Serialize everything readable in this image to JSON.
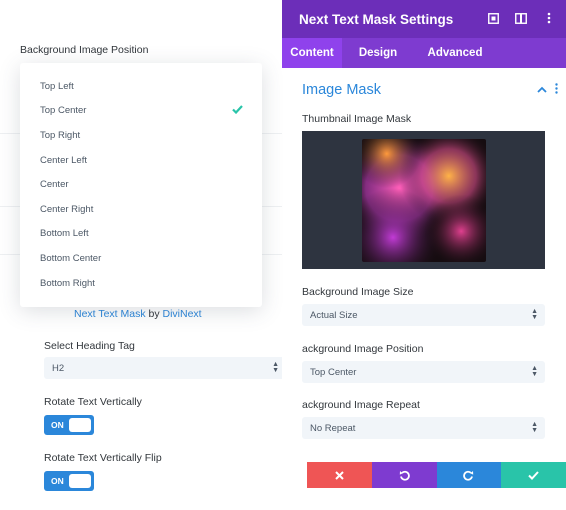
{
  "panel": {
    "title": "Next Text Mask Settings",
    "tabs": [
      "Content",
      "Design",
      "Advanced"
    ],
    "active_tab": "Content",
    "section_title": "Image Mask",
    "thumbnail_label": "Thumbnail Image Mask",
    "size_label": "Background Image Size",
    "size_value": "Actual Size",
    "position_label": "ackground Image Position",
    "position_value": "Top Center",
    "repeat_label": "ackground Image Repeat",
    "repeat_value": "No Repeat"
  },
  "left": {
    "position_label": "Background Image Position",
    "credit_prefix": "Next Text Mask",
    "credit_by": "by",
    "credit_link": "DiviNext",
    "heading_tag_label": "Select Heading Tag",
    "heading_tag_value": "H2",
    "rotate_label": "Rotate Text Vertically",
    "rotate_flip_label": "Rotate Text Vertically Flip",
    "toggle_on": "ON"
  },
  "dropdown": {
    "options": [
      "Top Left",
      "Top Center",
      "Top Right",
      "Center Left",
      "Center",
      "Center Right",
      "Bottom Left",
      "Bottom Center",
      "Bottom Right"
    ],
    "selected": "Top Center"
  },
  "colors": {
    "header": "#6c2eb9",
    "tabs": "#7e3bd0",
    "accent": "#2b87da",
    "cancel": "#ef5555",
    "save": "#29c4a9"
  }
}
